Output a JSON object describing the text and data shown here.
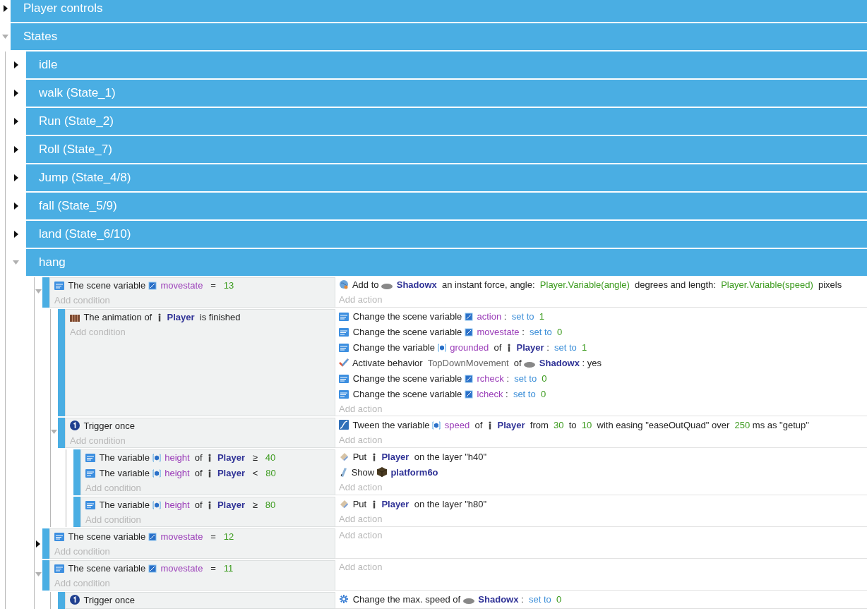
{
  "groups": [
    {
      "title": "Player controls",
      "expanded": false
    },
    {
      "title": "States",
      "expanded": true,
      "children": [
        {
          "title": "idle",
          "expanded": false
        },
        {
          "title": "walk (State_1)",
          "expanded": false
        },
        {
          "title": "Run (State_2)",
          "expanded": false
        },
        {
          "title": "Roll (State_7)",
          "expanded": false
        },
        {
          "title": "Jump (State_4/8)",
          "expanded": false
        },
        {
          "title": "fall (State_5/9)",
          "expanded": false
        },
        {
          "title": "land (State_6/10)",
          "expanded": false
        },
        {
          "title": "hang",
          "expanded": true,
          "events": [
            {
              "expanded": true,
              "conditions": [
                {
                  "kind": "variable",
                  "parts": [
                    {
                      "kind": "text",
                      "text": "The scene variable "
                    },
                    {
                      "kind": "scene_variable",
                      "text": "movestate"
                    },
                    {
                      "kind": "text",
                      "text": "  =  "
                    },
                    {
                      "kind": "value",
                      "text": "13"
                    }
                  ]
                }
              ],
              "add_condition": "Add condition",
              "actions": [
                {
                  "kind": "force",
                  "parts": [
                    {
                      "kind": "text",
                      "text": "Add to "
                    },
                    {
                      "kind": "ellipse_object",
                      "text": "Shadowx"
                    },
                    {
                      "kind": "text",
                      "text": " an instant force, angle: "
                    },
                    {
                      "kind": "value",
                      "text": "Player.Variable(angle)"
                    },
                    {
                      "kind": "text",
                      "text": " degrees and length: "
                    },
                    {
                      "kind": "value",
                      "text": "Player.Variable(speed)"
                    },
                    {
                      "kind": "text",
                      "text": " pixels"
                    }
                  ]
                }
              ],
              "add_action": "Add action",
              "children": [
                {
                  "conditions": [
                    {
                      "kind": "animation",
                      "parts": [
                        {
                          "kind": "text",
                          "text": "The animation of "
                        },
                        {
                          "kind": "figure_object",
                          "text": "Player"
                        },
                        {
                          "kind": "text",
                          "text": " is finished"
                        }
                      ]
                    }
                  ],
                  "add_condition": "Add condition",
                  "actions": [
                    {
                      "kind": "variable",
                      "parts": [
                        {
                          "kind": "text",
                          "text": "Change the scene variable "
                        },
                        {
                          "kind": "scene_variable",
                          "text": "action"
                        },
                        {
                          "kind": "text",
                          "text": ": "
                        },
                        {
                          "kind": "operation",
                          "text": "set to "
                        },
                        {
                          "kind": "value",
                          "text": "1"
                        }
                      ]
                    },
                    {
                      "kind": "variable",
                      "parts": [
                        {
                          "kind": "text",
                          "text": "Change the scene variable "
                        },
                        {
                          "kind": "scene_variable",
                          "text": "movestate"
                        },
                        {
                          "kind": "text",
                          "text": ": "
                        },
                        {
                          "kind": "operation",
                          "text": "set to "
                        },
                        {
                          "kind": "value",
                          "text": "0"
                        }
                      ]
                    },
                    {
                      "kind": "variable",
                      "parts": [
                        {
                          "kind": "text",
                          "text": "Change the variable "
                        },
                        {
                          "kind": "object_variable",
                          "text": "grounded"
                        },
                        {
                          "kind": "text",
                          "text": " of "
                        },
                        {
                          "kind": "figure_object",
                          "text": "Player"
                        },
                        {
                          "kind": "text",
                          "text": ": "
                        },
                        {
                          "kind": "operation",
                          "text": "set to "
                        },
                        {
                          "kind": "value",
                          "text": "1"
                        }
                      ]
                    },
                    {
                      "kind": "behavior",
                      "parts": [
                        {
                          "kind": "text",
                          "text": "Activate behavior "
                        },
                        {
                          "kind": "behavior",
                          "text": "TopDownMovement"
                        },
                        {
                          "kind": "text",
                          "text": " of "
                        },
                        {
                          "kind": "ellipse_object",
                          "text": "Shadowx"
                        },
                        {
                          "kind": "text",
                          "text": ": yes"
                        }
                      ]
                    },
                    {
                      "kind": "variable",
                      "parts": [
                        {
                          "kind": "text",
                          "text": "Change the scene variable "
                        },
                        {
                          "kind": "scene_variable",
                          "text": "rcheck"
                        },
                        {
                          "kind": "text",
                          "text": ": "
                        },
                        {
                          "kind": "operation",
                          "text": "set to "
                        },
                        {
                          "kind": "value",
                          "text": "0"
                        }
                      ]
                    },
                    {
                      "kind": "variable",
                      "parts": [
                        {
                          "kind": "text",
                          "text": "Change the scene variable "
                        },
                        {
                          "kind": "scene_variable",
                          "text": "lcheck"
                        },
                        {
                          "kind": "text",
                          "text": ": "
                        },
                        {
                          "kind": "operation",
                          "text": "set to "
                        },
                        {
                          "kind": "value",
                          "text": "0"
                        }
                      ]
                    }
                  ],
                  "add_action": "Add action"
                },
                {
                  "expanded": true,
                  "conditions": [
                    {
                      "kind": "trigger",
                      "parts": [
                        {
                          "kind": "text",
                          "text": "Trigger once"
                        }
                      ]
                    }
                  ],
                  "add_condition": "Add condition",
                  "actions": [
                    {
                      "kind": "tween",
                      "parts": [
                        {
                          "kind": "text",
                          "text": "Tween the variable "
                        },
                        {
                          "kind": "object_variable",
                          "text": "speed"
                        },
                        {
                          "kind": "text",
                          "text": " of "
                        },
                        {
                          "kind": "figure_object",
                          "text": "Player"
                        },
                        {
                          "kind": "text",
                          "text": " from "
                        },
                        {
                          "kind": "value",
                          "text": "30"
                        },
                        {
                          "kind": "text",
                          "text": " to "
                        },
                        {
                          "kind": "value",
                          "text": "10"
                        },
                        {
                          "kind": "text",
                          "text": " with easing \"easeOutQuad\" over "
                        },
                        {
                          "kind": "value",
                          "text": "250"
                        },
                        {
                          "kind": "text",
                          "text": "ms as \"getup\""
                        }
                      ]
                    }
                  ],
                  "add_action": "Add action",
                  "children": [
                    {
                      "conditions": [
                        {
                          "kind": "variable",
                          "parts": [
                            {
                              "kind": "text",
                              "text": "The variable "
                            },
                            {
                              "kind": "object_variable",
                              "text": "height"
                            },
                            {
                              "kind": "text",
                              "text": " of "
                            },
                            {
                              "kind": "figure_object",
                              "text": "Player"
                            },
                            {
                              "kind": "text",
                              "text": "  ≥  "
                            },
                            {
                              "kind": "value",
                              "text": "40"
                            }
                          ]
                        },
                        {
                          "kind": "variable",
                          "parts": [
                            {
                              "kind": "text",
                              "text": "The variable "
                            },
                            {
                              "kind": "object_variable",
                              "text": "height"
                            },
                            {
                              "kind": "text",
                              "text": " of "
                            },
                            {
                              "kind": "figure_object",
                              "text": "Player"
                            },
                            {
                              "kind": "text",
                              "text": "  <  "
                            },
                            {
                              "kind": "value",
                              "text": "80"
                            }
                          ]
                        }
                      ],
                      "add_condition": "Add condition",
                      "actions": [
                        {
                          "kind": "layer",
                          "parts": [
                            {
                              "kind": "text",
                              "text": "Put "
                            },
                            {
                              "kind": "figure_object",
                              "text": "Player"
                            },
                            {
                              "kind": "text",
                              "text": " on the layer \"h40\""
                            }
                          ]
                        },
                        {
                          "kind": "visibility",
                          "parts": [
                            {
                              "kind": "text",
                              "text": "Show "
                            },
                            {
                              "kind": "cube_object",
                              "text": "platform6o"
                            }
                          ]
                        }
                      ],
                      "add_action": "Add action"
                    },
                    {
                      "conditions": [
                        {
                          "kind": "variable",
                          "parts": [
                            {
                              "kind": "text",
                              "text": "The variable "
                            },
                            {
                              "kind": "object_variable",
                              "text": "height"
                            },
                            {
                              "kind": "text",
                              "text": " of "
                            },
                            {
                              "kind": "figure_object",
                              "text": "Player"
                            },
                            {
                              "kind": "text",
                              "text": "  ≥  "
                            },
                            {
                              "kind": "value",
                              "text": "80"
                            }
                          ]
                        }
                      ],
                      "add_condition": "Add condition",
                      "actions": [
                        {
                          "kind": "layer",
                          "parts": [
                            {
                              "kind": "text",
                              "text": "Put "
                            },
                            {
                              "kind": "figure_object",
                              "text": "Player"
                            },
                            {
                              "kind": "text",
                              "text": " on the layer \"h80\""
                            }
                          ]
                        }
                      ],
                      "add_action": "Add action"
                    }
                  ]
                }
              ]
            },
            {
              "expanded": false,
              "conditions": [
                {
                  "kind": "variable",
                  "parts": [
                    {
                      "kind": "text",
                      "text": "The scene variable "
                    },
                    {
                      "kind": "scene_variable",
                      "text": "movestate"
                    },
                    {
                      "kind": "text",
                      "text": "  =  "
                    },
                    {
                      "kind": "value",
                      "text": "12"
                    }
                  ]
                }
              ],
              "add_condition": "Add condition",
              "add_action": "Add action"
            },
            {
              "expanded": true,
              "conditions": [
                {
                  "kind": "variable",
                  "parts": [
                    {
                      "kind": "text",
                      "text": "The scene variable "
                    },
                    {
                      "kind": "scene_variable",
                      "text": "movestate"
                    },
                    {
                      "kind": "text",
                      "text": "  =  "
                    },
                    {
                      "kind": "value",
                      "text": "11"
                    }
                  ]
                }
              ],
              "add_condition": "Add condition",
              "add_action": "Add action",
              "children": [
                {
                  "conditions": [
                    {
                      "kind": "trigger",
                      "parts": [
                        {
                          "kind": "text",
                          "text": "Trigger once"
                        }
                      ]
                    }
                  ],
                  "actions": [
                    {
                      "kind": "max_speed",
                      "parts": [
                        {
                          "kind": "text",
                          "text": "Change the max. speed of "
                        },
                        {
                          "kind": "ellipse_object",
                          "text": "Shadowx"
                        },
                        {
                          "kind": "text",
                          "text": ": "
                        },
                        {
                          "kind": "operation",
                          "text": "set to "
                        },
                        {
                          "kind": "value",
                          "text": "0"
                        }
                      ]
                    }
                  ]
                }
              ]
            }
          ]
        }
      ]
    }
  ]
}
